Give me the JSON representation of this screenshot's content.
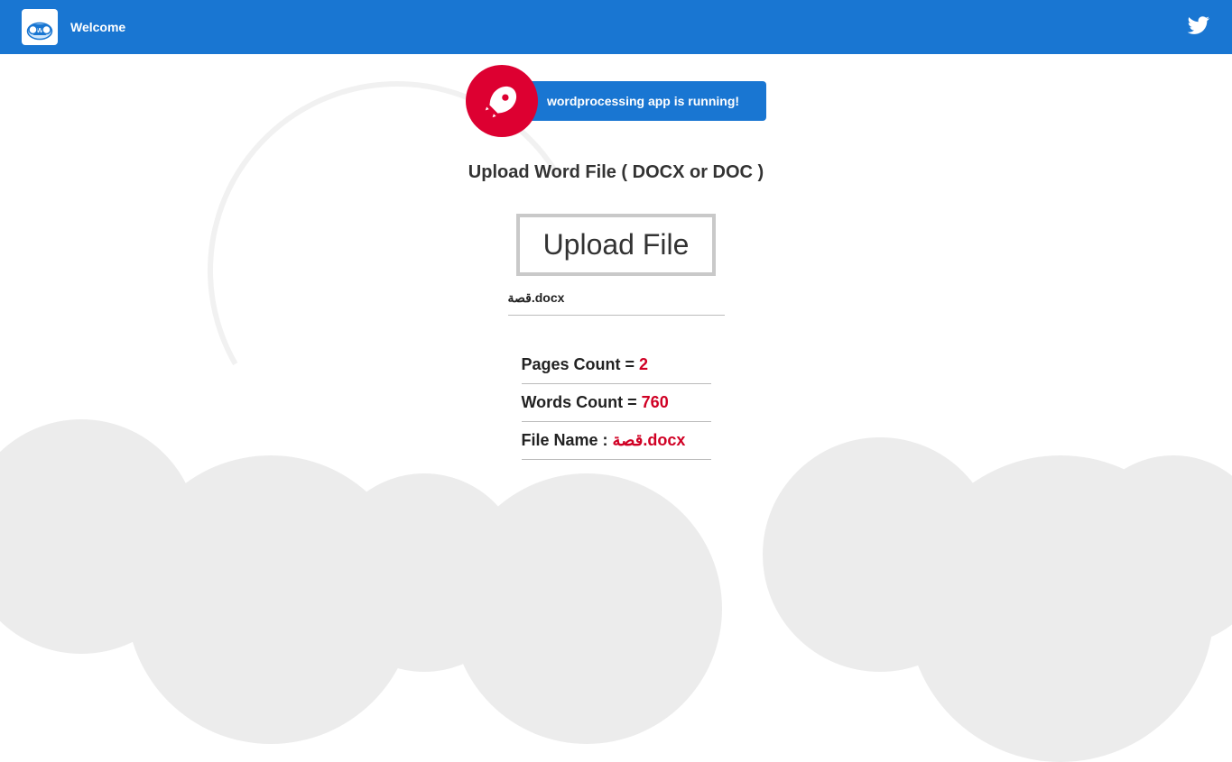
{
  "header": {
    "title": "Welcome"
  },
  "banner": {
    "text": "wordprocessing app is running!"
  },
  "section": {
    "title": "Upload Word File ( DOCX or DOC )"
  },
  "upload": {
    "button_label": "Upload File",
    "filename": "قصة.docx"
  },
  "stats": {
    "pages_label": "Pages Count = ",
    "pages_value": "2",
    "words_label": "Words Count = ",
    "words_value": "760",
    "filename_label": "File Name : ",
    "filename_value": "قصة.docx"
  },
  "colors": {
    "accent": "#1976d2",
    "danger": "#dd0031",
    "value_red": "#d00024"
  }
}
